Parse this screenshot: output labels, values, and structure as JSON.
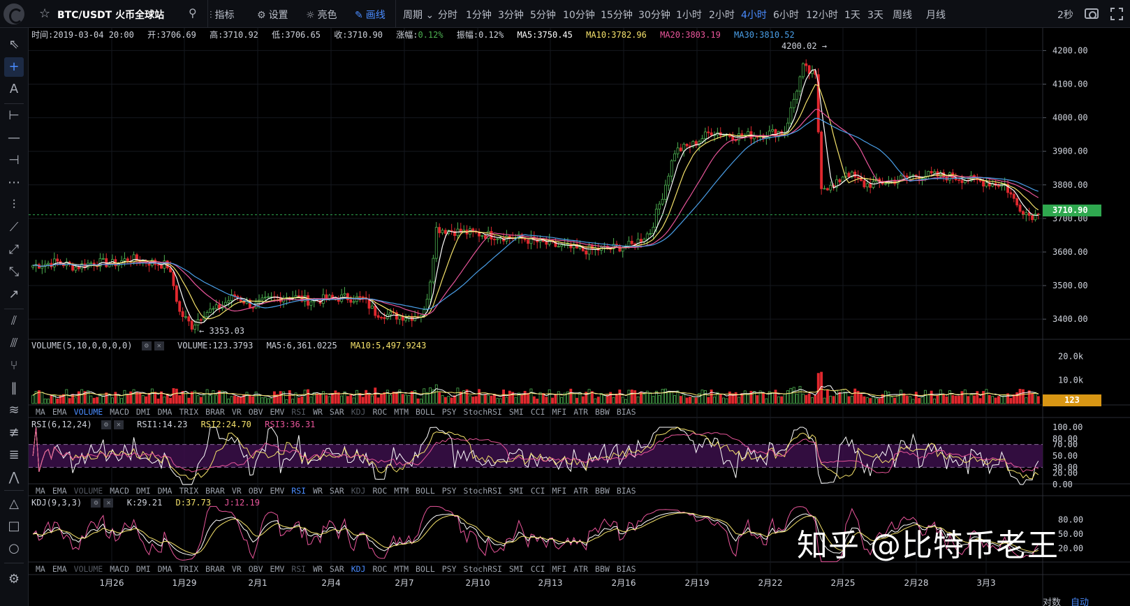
{
  "header": {
    "symbol": "BTC/USDT 火币全球站",
    "tools": [
      {
        "icon": "indicator-icon",
        "label": "指标"
      },
      {
        "icon": "gear-icon",
        "label": "设置"
      },
      {
        "icon": "sun-icon",
        "label": "亮色"
      },
      {
        "icon": "pencil-icon",
        "label": "画线"
      }
    ],
    "period_label": "周期",
    "periods": [
      "分时",
      "1分钟",
      "3分钟",
      "5分钟",
      "10分钟",
      "15分钟",
      "30分钟",
      "1小时",
      "2小时",
      "4小时",
      "6小时",
      "12小时",
      "1天",
      "3天",
      "周线",
      "月线"
    ],
    "active_period": "4小时",
    "refresh": "2秒"
  },
  "candle_info": {
    "time": "时间:2019-03-04 20:00",
    "open": "开:3706.69",
    "high": "高:3710.92",
    "low": "低:3706.65",
    "close": "收:3710.90",
    "change_label": "涨幅:",
    "change_value": "0.12%",
    "amplitude": "振幅:0.12%",
    "ma5": "MA5:3750.45",
    "ma10": "MA10:3782.96",
    "ma20": "MA20:3803.19",
    "ma30": "MA30:3810.52"
  },
  "volume_info": {
    "name": "VOLUME(5,10,0,0,0,0)",
    "value": "VOLUME:123.3793",
    "ma5": "MA5:6,361.0225",
    "ma10": "MA10:5,497.9243"
  },
  "rsi_info": {
    "name": "RSI(6,12,24)",
    "rsi1": "RSI1:14.23",
    "rsi2": "RSI2:24.70",
    "rsi3": "RSI3:36.31"
  },
  "kdj_info": {
    "name": "KDJ(9,3,3)",
    "k": "K:29.21",
    "d": "D:37.73",
    "j": "J:12.19"
  },
  "indicator_tabs": [
    "MA",
    "EMA",
    "VOLUME",
    "MACD",
    "DMI",
    "DMA",
    "TRIX",
    "BRAR",
    "VR",
    "OBV",
    "EMV",
    "RSI",
    "WR",
    "SAR",
    "KDJ",
    "ROC",
    "MTM",
    "BOLL",
    "PSY",
    "StochRSI",
    "SMI",
    "CCI",
    "MFI",
    "ATR",
    "BBW",
    "BIAS"
  ],
  "price_axis": [
    "4200.00",
    "4100.00",
    "4000.00",
    "3900.00",
    "3800.00",
    "3700.00",
    "3600.00",
    "3500.00",
    "3400.00"
  ],
  "volume_axis": [
    "20.0k",
    "10.0k"
  ],
  "rsi_axis": [
    "100.00",
    "80.00",
    "70.00",
    "50.00",
    "30.00",
    "20.00",
    "0.00"
  ],
  "kdj_axis": [
    "80.00",
    "50.00",
    "20.00"
  ],
  "date_axis": [
    "1月26",
    "1月29",
    "2月1",
    "2月4",
    "2月7",
    "2月10",
    "2月13",
    "2月16",
    "2月19",
    "2月22",
    "2月25",
    "2月28",
    "3月3"
  ],
  "annotations": {
    "high": "4200.02 →",
    "low": "← 3353.03"
  },
  "last_price": "3710.90",
  "last_volume": "123",
  "axis_mode": [
    "对数",
    "自动"
  ],
  "watermark": "知乎 @比特币老王",
  "colors": {
    "up": "#4caf50",
    "down": "#e0282e",
    "ma5": "#ffffff",
    "ma10": "#f5e26b",
    "ma20": "#e8559a",
    "ma30": "#4a9fe8",
    "accent": "#4a8cff"
  },
  "chart_data": {
    "type": "candlestick",
    "price_range": [
      3340,
      4230
    ],
    "close_key_points": [
      [
        0,
        3560
      ],
      [
        8,
        3570
      ],
      [
        14,
        3555
      ],
      [
        20,
        3570
      ],
      [
        26,
        3565
      ],
      [
        32,
        3580
      ],
      [
        38,
        3570
      ],
      [
        44,
        3560
      ],
      [
        46,
        3500
      ],
      [
        48,
        3420
      ],
      [
        52,
        3380
      ],
      [
        56,
        3420
      ],
      [
        60,
        3430
      ],
      [
        66,
        3470
      ],
      [
        72,
        3440
      ],
      [
        78,
        3460
      ],
      [
        84,
        3470
      ],
      [
        90,
        3455
      ],
      [
        96,
        3460
      ],
      [
        102,
        3465
      ],
      [
        108,
        3460
      ],
      [
        112,
        3420
      ],
      [
        118,
        3410
      ],
      [
        124,
        3408
      ],
      [
        128,
        3420
      ],
      [
        130,
        3520
      ],
      [
        132,
        3670
      ],
      [
        140,
        3660
      ],
      [
        150,
        3650
      ],
      [
        160,
        3640
      ],
      [
        170,
        3620
      ],
      [
        180,
        3605
      ],
      [
        188,
        3610
      ],
      [
        196,
        3620
      ],
      [
        202,
        3660
      ],
      [
        206,
        3770
      ],
      [
        210,
        3900
      ],
      [
        216,
        3920
      ],
      [
        222,
        3960
      ],
      [
        230,
        3945
      ],
      [
        238,
        3950
      ],
      [
        246,
        3960
      ],
      [
        252,
        4150
      ],
      [
        256,
        4120
      ],
      [
        258,
        3800
      ],
      [
        262,
        3790
      ],
      [
        266,
        3840
      ],
      [
        272,
        3800
      ],
      [
        280,
        3810
      ],
      [
        290,
        3830
      ],
      [
        300,
        3825
      ],
      [
        310,
        3810
      ],
      [
        318,
        3800
      ],
      [
        322,
        3740
      ],
      [
        326,
        3710
      ]
    ],
    "series": [
      {
        "name": "MA5",
        "values": [
          3750.45
        ]
      },
      {
        "name": "MA10",
        "values": [
          3782.96
        ]
      },
      {
        "name": "MA20",
        "values": [
          3803.19
        ]
      },
      {
        "name": "MA30",
        "values": [
          3810.52
        ]
      }
    ],
    "last": {
      "open": 3706.69,
      "high": 3710.92,
      "low": 3706.65,
      "close": 3710.9,
      "volume": 123.3793
    },
    "max_label": 4200.02,
    "min_label": 3353.03
  }
}
